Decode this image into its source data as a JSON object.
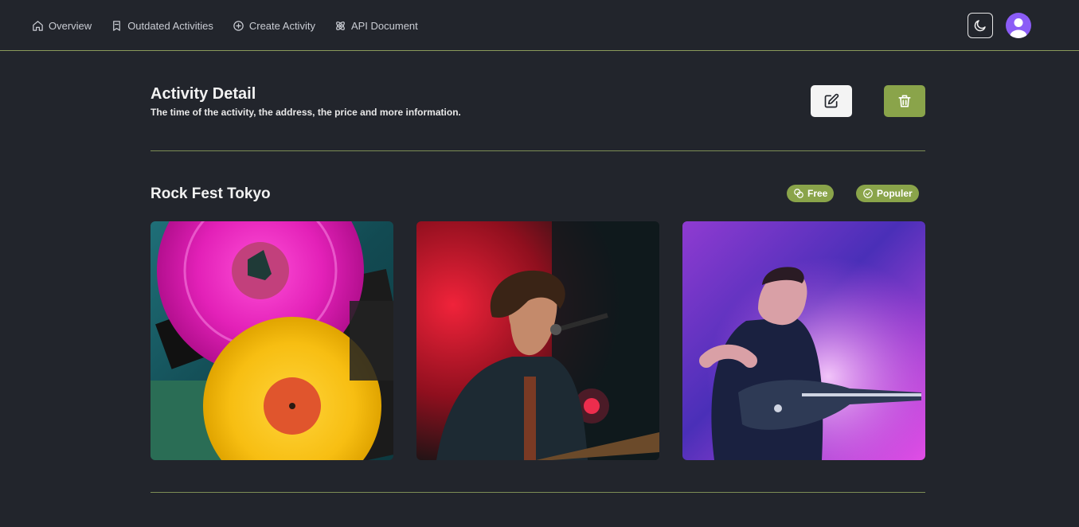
{
  "nav": {
    "items": [
      {
        "label": "Overview",
        "icon": "home-icon"
      },
      {
        "label": "Outdated Activities",
        "icon": "bookmark-icon"
      },
      {
        "label": "Create Activity",
        "icon": "plus-circle-icon"
      },
      {
        "label": "API Document",
        "icon": "atom-icon"
      }
    ],
    "theme_toggle_icon": "moon-icon",
    "avatar_icon": "user-icon"
  },
  "header": {
    "title": "Activity Detail",
    "subtitle": "The time of the activity, the address, the price and more information.",
    "edit_icon": "edit-icon",
    "delete_icon": "trash-icon"
  },
  "event": {
    "title": "Rock Fest Tokyo",
    "badges": [
      {
        "label": "Free",
        "icon": "coins-icon"
      },
      {
        "label": "Populer",
        "icon": "check-circle-icon"
      }
    ],
    "photos": [
      "vinyl-records-photo",
      "singer-with-guitar-photo",
      "guitarist-on-stage-photo"
    ]
  },
  "colors": {
    "background": "#22252c",
    "accent": "#8aa44a",
    "divider": "#7d8d55",
    "avatar": "#8b5cf6"
  }
}
